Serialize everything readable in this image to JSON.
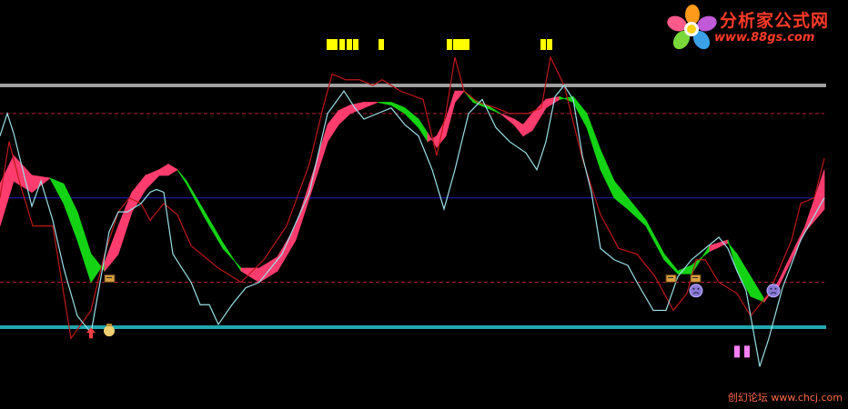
{
  "chart_data": {
    "type": "line",
    "ylim": [
      0,
      100
    ],
    "xlim": [
      0,
      906
    ],
    "grid": false,
    "legend": "none",
    "reference_lines": [
      {
        "name": "upper",
        "value": 90,
        "style": "solid",
        "color": "#a0a0a0"
      },
      {
        "name": "upper-dashed",
        "value": 80,
        "style": "dashed",
        "color": "#b0203c"
      },
      {
        "name": "middle",
        "value": 50,
        "style": "solid",
        "color": "#2020c0"
      },
      {
        "name": "lower-dashed",
        "value": 20,
        "style": "dashed",
        "color": "#b0203c"
      },
      {
        "name": "lower",
        "value": 4,
        "style": "solid",
        "color": "#20a8b0"
      }
    ],
    "colors": {
      "ribbon_up": "#ff3c6e",
      "ribbon_down": "#14d214",
      "fast_line": "#c01818",
      "slow_line": "#9ae0e8",
      "top_signal": "#ffff00",
      "bottom_signal": "#ff80ff"
    },
    "series": [
      {
        "key": "fast",
        "x": [
          0,
          10,
          22,
          36,
          48,
          58,
          78,
          100,
          115,
          130,
          142,
          155,
          165,
          180,
          195,
          210,
          240,
          265,
          290,
          315,
          340,
          355,
          365,
          380,
          395,
          410,
          420,
          440,
          465,
          480,
          490,
          500,
          510,
          525,
          545,
          560,
          580,
          595,
          605,
          620,
          640,
          660,
          680,
          700,
          720,
          740,
          755,
          765,
          775,
          790,
          810,
          825,
          845,
          870,
          880,
          895,
          906
        ],
        "y": [
          50,
          70,
          55,
          40,
          40,
          40,
          0,
          10,
          30,
          45,
          50,
          48,
          42,
          48,
          44,
          33,
          25,
          20,
          28,
          40,
          62,
          82,
          94,
          92,
          92,
          90,
          92,
          88,
          85,
          65,
          80,
          100,
          88,
          84,
          82,
          80,
          80,
          82,
          100,
          90,
          64,
          44,
          32,
          30,
          22,
          10,
          16,
          28,
          28,
          20,
          16,
          8,
          16,
          35,
          48,
          50,
          64
        ]
      },
      {
        "key": "slow",
        "x": [
          0,
          8,
          15,
          25,
          35,
          45,
          58,
          70,
          85,
          100,
          110,
          120,
          130,
          140,
          155,
          165,
          172,
          180,
          190,
          200,
          210,
          220,
          230,
          240,
          255,
          270,
          285,
          310,
          340,
          360,
          378,
          390,
          400,
          415,
          430,
          445,
          460,
          475,
          488,
          500,
          515,
          530,
          545,
          560,
          578,
          590,
          600,
          610,
          620,
          630,
          640,
          650,
          660,
          675,
          690,
          700,
          718,
          732,
          745,
          760,
          775,
          790,
          800,
          810,
          820,
          835,
          845,
          860,
          880,
          906
        ],
        "y": [
          72,
          80,
          73,
          60,
          47,
          56,
          42,
          25,
          8,
          2,
          20,
          38,
          45,
          45,
          48,
          52,
          53,
          52,
          30,
          25,
          20,
          12,
          12,
          5,
          12,
          18,
          20,
          30,
          52,
          80,
          88,
          82,
          78,
          80,
          82,
          76,
          72,
          60,
          46,
          60,
          80,
          85,
          75,
          70,
          66,
          60,
          70,
          86,
          90,
          85,
          65,
          52,
          32,
          28,
          26,
          20,
          10,
          10,
          22,
          28,
          32,
          36,
          32,
          24,
          17,
          -10,
          0,
          18,
          35,
          50
        ]
      }
    ],
    "ribbon": {
      "x": [
        0,
        15,
        35,
        55,
        70,
        85,
        100,
        115,
        130,
        145,
        160,
        175,
        185,
        195,
        205,
        225,
        245,
        265,
        285,
        305,
        325,
        345,
        360,
        372,
        385,
        400,
        415,
        430,
        445,
        460,
        470,
        480,
        490,
        500,
        510,
        520,
        535,
        550,
        565,
        575,
        585,
        600,
        615,
        630,
        645,
        660,
        675,
        690,
        710,
        730,
        745,
        760,
        780,
        800,
        810,
        825,
        840,
        855,
        870,
        885,
        906
      ],
      "a": [
        55,
        65,
        58,
        57,
        48,
        35,
        20,
        27,
        40,
        52,
        58,
        60,
        62,
        60,
        55,
        43,
        32,
        25,
        25,
        29,
        40,
        60,
        76,
        81,
        83,
        84,
        84,
        83,
        80,
        75,
        70,
        72,
        78,
        88,
        88,
        84,
        82,
        80,
        78,
        76,
        80,
        85,
        86,
        84,
        75,
        60,
        50,
        46,
        40,
        28,
        23,
        23,
        33,
        35,
        24,
        15,
        13,
        20,
        30,
        40,
        60
      ],
      "b": [
        40,
        56,
        52,
        57,
        55,
        45,
        30,
        24,
        30,
        45,
        53,
        58,
        58,
        60,
        56,
        45,
        34,
        24,
        20,
        24,
        35,
        55,
        70,
        76,
        80,
        82,
        84,
        84,
        82,
        78,
        73,
        68,
        72,
        84,
        88,
        85,
        83,
        80,
        76,
        72,
        74,
        82,
        85,
        86,
        80,
        67,
        56,
        50,
        42,
        30,
        24,
        26,
        31,
        34,
        30,
        22,
        14,
        18,
        28,
        38,
        46
      ]
    },
    "top_markers_x": [
      362,
      368,
      376,
      384,
      391,
      419,
      494,
      501,
      507,
      513,
      597,
      604
    ],
    "bottom_markers_x": [
      810,
      821
    ],
    "annotations": [
      {
        "kind": "up-arrow",
        "x": 100,
        "value": 2
      },
      {
        "kind": "money-bag",
        "x": 120,
        "value": 3
      },
      {
        "kind": "note-flag",
        "x": 120,
        "value": 21
      },
      {
        "kind": "note-flag",
        "x": 737,
        "value": 21
      },
      {
        "kind": "note-flag",
        "x": 764,
        "value": 21
      },
      {
        "kind": "sad-face",
        "x": 765,
        "value": 17
      },
      {
        "kind": "sad-face",
        "x": 850,
        "value": 17
      }
    ]
  },
  "branding": {
    "title": "分析家公式网",
    "url": "www.88gs.com",
    "watermark": "创幻论坛 www.chcj.com"
  }
}
